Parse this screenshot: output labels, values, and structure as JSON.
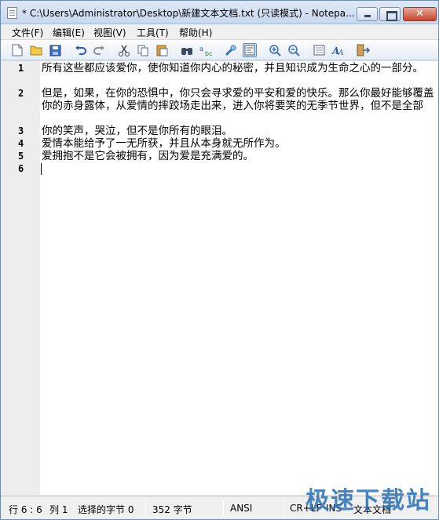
{
  "window": {
    "title": "* C:\\Users\\Administrator\\Desktop\\新建文本文档.txt (只读模式) - Notepa..."
  },
  "menu": [
    "文件(F)",
    "编辑(E)",
    "视图(V)",
    "工具(T)",
    "帮助(H)"
  ],
  "toolbar_icons": [
    "new-file-icon",
    "open-folder-icon",
    "save-icon",
    "undo-icon",
    "redo-icon",
    "cut-icon",
    "copy-icon",
    "paste-icon",
    "find-icon",
    "replace-icon",
    "goto-icon",
    "word-wrap-icon",
    "zoom-in-icon",
    "zoom-out-icon",
    "view-icon",
    "font-icon",
    "exit-icon"
  ],
  "editor": {
    "line_numbers": [
      "1",
      "2",
      "3",
      "4",
      "5",
      "6"
    ],
    "lines": [
      "所有这些都应该爱你，使你知道你内心的秘密，并且知识成为生命之心的一部分。",
      "但是，如果，在你的恐惧中，你只会寻求爱的平安和爱的快乐。那么你最好能够覆盖你的赤身露体，从爱情的摔跤场走出来，进入你将要笑的无季节世界，但不是全部",
      "你的笑声，哭泣，但不是你所有的眼泪。",
      "爱情本能给予了一无所获，并且从本身就无所作为。",
      "爱拥抱不是它会被拥有，因为爱是充满爱的。",
      ""
    ]
  },
  "status": {
    "position": "行 6 : 6",
    "column": "列 1",
    "selected": "选择的字节 0",
    "size": "352 字节",
    "encoding": "ANSI",
    "line_ending": "CR+LF",
    "mode": "INS",
    "doc_type": "文本文档"
  },
  "watermark": "极速下载站"
}
